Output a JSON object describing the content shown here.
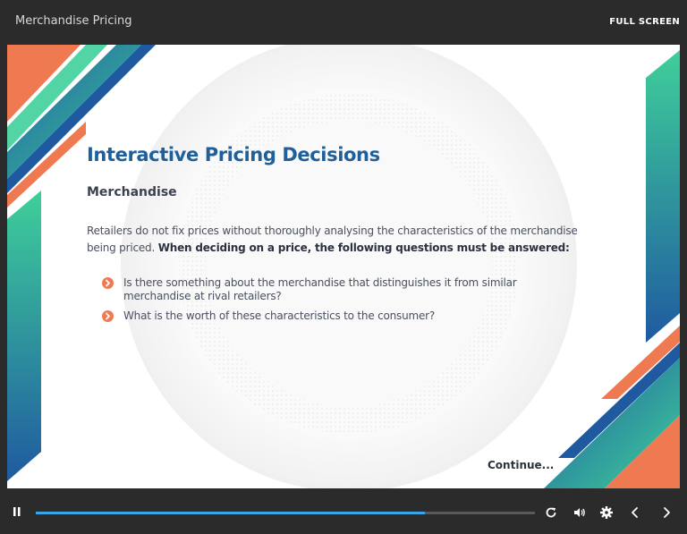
{
  "header": {
    "course_title": "Merchandise Pricing",
    "fullscreen_label": "FULL SCREEN"
  },
  "slide": {
    "heading": "Interactive Pricing Decisions",
    "subheading": "Merchandise",
    "intro_text": "Retailers do not fix prices without thoroughly analysing the characteristics of the merchandise being priced.",
    "intro_bold": "When deciding on a price, the following questions must be answered:",
    "bullets": [
      "Is there something about the merchandise that distinguishes it from similar merchandise at rival retailers?",
      "What is the worth of these characteristics to the consumer?"
    ],
    "continue_label": "Continue..."
  },
  "player": {
    "progress_fraction": 0.78,
    "icons": [
      "pause-icon",
      "replay-icon",
      "volume-icon",
      "settings-gear-icon",
      "previous-chevron-icon",
      "next-chevron-icon"
    ]
  },
  "colors": {
    "accent_blue": "#1f5f9a",
    "accent_orange": "#ef7a52",
    "accent_teal": "#3fcf9a",
    "progress": "#3aa6e6",
    "chrome": "#2b2b2b"
  }
}
